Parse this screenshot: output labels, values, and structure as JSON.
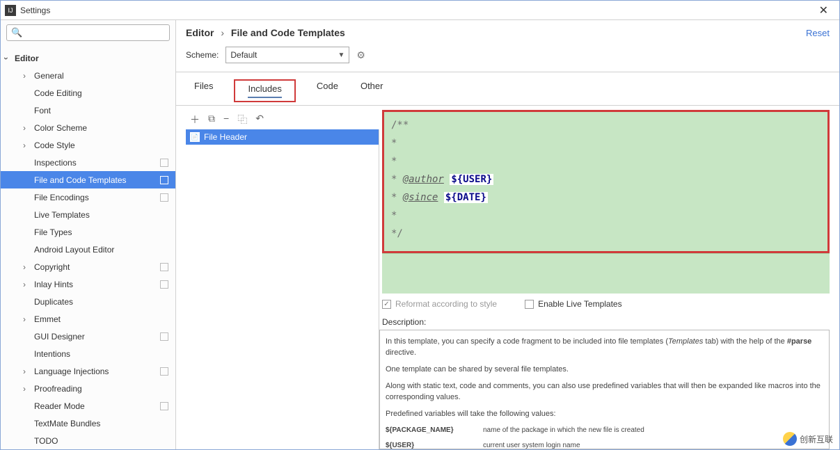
{
  "window": {
    "title": "Settings"
  },
  "sidebar": {
    "search_placeholder": "",
    "items": [
      {
        "label": "Editor",
        "children": true,
        "lvl": 0,
        "expanded": true
      },
      {
        "label": "General",
        "children": true,
        "lvl": 1,
        "expanded": false
      },
      {
        "label": "Code Editing",
        "children": false,
        "lvl": 2
      },
      {
        "label": "Font",
        "children": false,
        "lvl": 2
      },
      {
        "label": "Color Scheme",
        "children": true,
        "lvl": 1,
        "expanded": false
      },
      {
        "label": "Code Style",
        "children": true,
        "lvl": 1,
        "expanded": false
      },
      {
        "label": "Inspections",
        "children": false,
        "lvl": 2,
        "bookmark": true
      },
      {
        "label": "File and Code Templates",
        "children": false,
        "lvl": 2,
        "selected": true,
        "bookmark": true
      },
      {
        "label": "File Encodings",
        "children": false,
        "lvl": 2,
        "bookmark": true
      },
      {
        "label": "Live Templates",
        "children": false,
        "lvl": 2
      },
      {
        "label": "File Types",
        "children": false,
        "lvl": 2
      },
      {
        "label": "Android Layout Editor",
        "children": false,
        "lvl": 2
      },
      {
        "label": "Copyright",
        "children": true,
        "lvl": 1,
        "expanded": false,
        "bookmark": true
      },
      {
        "label": "Inlay Hints",
        "children": true,
        "lvl": 1,
        "expanded": false,
        "bookmark": true
      },
      {
        "label": "Duplicates",
        "children": false,
        "lvl": 2
      },
      {
        "label": "Emmet",
        "children": true,
        "lvl": 1,
        "expanded": false
      },
      {
        "label": "GUI Designer",
        "children": false,
        "lvl": 2,
        "bookmark": true
      },
      {
        "label": "Intentions",
        "children": false,
        "lvl": 2
      },
      {
        "label": "Language Injections",
        "children": true,
        "lvl": 1,
        "expanded": false,
        "bookmark": true
      },
      {
        "label": "Proofreading",
        "children": true,
        "lvl": 1,
        "expanded": false
      },
      {
        "label": "Reader Mode",
        "children": false,
        "lvl": 2,
        "bookmark": true
      },
      {
        "label": "TextMate Bundles",
        "children": false,
        "lvl": 2
      },
      {
        "label": "TODO",
        "children": false,
        "lvl": 2
      }
    ]
  },
  "breadcrumb": {
    "a": "Editor",
    "b": "File and Code Templates",
    "reset": "Reset"
  },
  "scheme": {
    "label": "Scheme:",
    "value": "Default"
  },
  "tabs": {
    "files": "Files",
    "includes": "Includes",
    "code": "Code",
    "other": "Other",
    "active": "includes"
  },
  "file_list": {
    "items": [
      {
        "label": "File Header",
        "selected": true
      }
    ]
  },
  "editor": {
    "lines": [
      {
        "text": "/**"
      },
      {
        "text": " *"
      },
      {
        "text": " *"
      },
      {
        "text": " * ",
        "tag": "@author",
        "var": "${USER}"
      },
      {
        "text": " * ",
        "tag": "@since",
        "var": "${DATE}"
      },
      {
        "text": " *"
      },
      {
        "text": " */"
      }
    ]
  },
  "checkboxes": {
    "reformat": "Reformat according to style",
    "enable_live": "Enable Live Templates"
  },
  "description": {
    "label": "Description:",
    "p1_a": "In this template, you can specify a code fragment to be included into file templates (",
    "p1_em": "Templates",
    "p1_b": " tab) with the help of the ",
    "p1_strong": "#parse",
    "p1_c": " directive.",
    "p2": "One template can be shared by several file templates.",
    "p3": "Along with static text, code and comments, you can also use predefined variables that will then be expanded like macros into the corresponding values.",
    "p4": "Predefined variables will take the following values:",
    "vars": [
      {
        "k": "${PACKAGE_NAME}",
        "v": "name of the package in which the new file is created"
      },
      {
        "k": "${USER}",
        "v": "current user system login name"
      }
    ]
  },
  "watermark": "创新互联"
}
